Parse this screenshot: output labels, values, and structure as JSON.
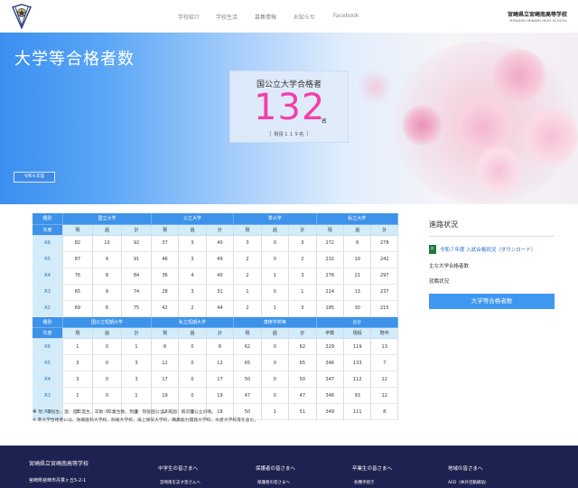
{
  "header": {
    "nav": [
      "学校紹介",
      "学校生活",
      "募集情報",
      "お知らせ",
      "Facebook"
    ],
    "school_jp": "宮崎県立宮崎南高等学校",
    "school_en": "MIYAZAKI MINAMI HIGH SCHOOL"
  },
  "hero": {
    "title": "大学等合格者数",
    "card_label": "国公立大学合格者",
    "count": "132",
    "unit": "名",
    "sub": "［ 現役１１９名 ］",
    "badge": "令和６年度"
  },
  "table": {
    "top_headers": [
      "種別",
      "国立大学",
      "公立大学",
      "準大学",
      "私立大学"
    ],
    "sub_headers": [
      "年度",
      "現",
      "過",
      "計",
      "現",
      "過",
      "計",
      "現",
      "過",
      "計",
      "現",
      "過",
      "計"
    ],
    "top_rows": [
      [
        "R6",
        "82",
        "10",
        "92",
        "37",
        "3",
        "40",
        "3",
        "0",
        "3",
        "272",
        "6",
        "278"
      ],
      [
        "R5",
        "87",
        "4",
        "91",
        "46",
        "3",
        "49",
        "2",
        "0",
        "2",
        "232",
        "10",
        "242"
      ],
      [
        "R4",
        "76",
        "8",
        "84",
        "36",
        "4",
        "40",
        "2",
        "1",
        "3",
        "276",
        "21",
        "297"
      ],
      [
        "R3",
        "65",
        "9",
        "74",
        "28",
        "3",
        "31",
        "1",
        "0",
        "1",
        "224",
        "13",
        "237"
      ],
      [
        "R2",
        "69",
        "6",
        "75",
        "42",
        "2",
        "44",
        "2",
        "1",
        "3",
        "185",
        "30",
        "215"
      ]
    ],
    "bottom_headers": [
      "種別",
      "国公立短期大学",
      "私立短期大学",
      "専修学校等",
      "合計"
    ],
    "bottom_sub_headers": [
      "年度",
      "現",
      "過",
      "計",
      "現",
      "過",
      "計",
      "現",
      "過",
      "計",
      "卒数",
      "現役",
      "既卒"
    ],
    "bottom_rows": [
      [
        "R6",
        "1",
        "0",
        "1",
        "8",
        "0",
        "8",
        "62",
        "0",
        "62",
        "329",
        "119",
        "13"
      ],
      [
        "R5",
        "3",
        "0",
        "3",
        "12",
        "0",
        "12",
        "65",
        "0",
        "65",
        "346",
        "133",
        "7"
      ],
      [
        "R4",
        "3",
        "0",
        "3",
        "17",
        "0",
        "17",
        "50",
        "0",
        "50",
        "347",
        "112",
        "12"
      ],
      [
        "R3",
        "1",
        "0",
        "1",
        "19",
        "0",
        "19",
        "47",
        "0",
        "47",
        "346",
        "93",
        "12"
      ],
      [
        "R2",
        "3",
        "0",
        "3",
        "18",
        "0",
        "18",
        "50",
        "1",
        "51",
        "349",
        "111",
        "8"
      ]
    ]
  },
  "notes": {
    "n1_mark": "※ ",
    "n1": "現：現役生、過：過年度生、卒数：卒業生数、現国：現役国公立、既国：既卒国公立の略。",
    "n2": "※ 準大学合格者には、防衛医科大学校、防衛大学校、海上保安大学校、職業能力開発大学校、水産大学校等を含む。"
  },
  "sidebar": {
    "title": "進路状況",
    "download": "令和７年度 入試合格状況（ダウンロード）",
    "links": [
      "主な大学合格者数",
      "就職状況"
    ],
    "button": "大学等合格者数"
  },
  "footer": {
    "name": "宮崎県立宮崎南高等学校",
    "address": "宮崎県宮崎市丹貫ヶ丘5-2-1",
    "cols": [
      "中学生の皆さまへ",
      "保護者の皆さまへ",
      "卒業生の皆さまへ",
      "地域の皆さまへ"
    ],
    "subs": [
      "宮崎南を志す皆さんへ",
      "保護者の皆さまへ",
      "各種手続き",
      "AED（休外活動補助）"
    ]
  },
  "colors": {
    "accent": "#3d92ea",
    "count": "#f23fa9",
    "footer": "#1e2250"
  }
}
